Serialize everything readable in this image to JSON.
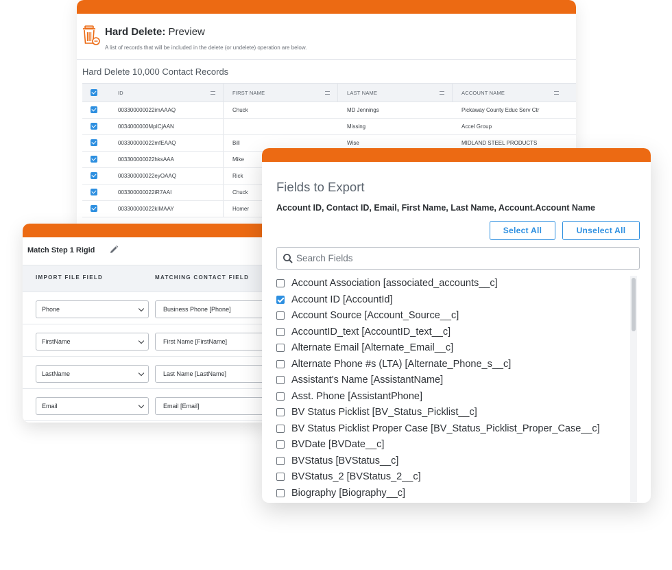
{
  "hard_delete": {
    "title_bold": "Hard Delete:",
    "title_rest": " Preview",
    "subtitle": "A list of records that will be included in the delete (or undelete) operation are below.",
    "heading": "Hard Delete 10,000 Contact Records",
    "columns": [
      "ID",
      "FIRST NAME",
      "LAST NAME",
      "ACCOUNT NAME"
    ],
    "rows": [
      {
        "id": "003300000022imAAAQ",
        "first": "Chuck",
        "last": "MD Jennings",
        "account": "Pickaway County Educ Serv Ctr"
      },
      {
        "id": "0034000000MpICjAAN",
        "first": "",
        "last": "Missing",
        "account": "Accel Group"
      },
      {
        "id": "003300000022mfEAAQ",
        "first": "Bill",
        "last": "Wise",
        "account": "MIDLAND STEEL PRODUCTS"
      },
      {
        "id": "003300000022hksAAA",
        "first": "Mike",
        "last": "",
        "account": ""
      },
      {
        "id": "003300000022eyOAAQ",
        "first": "Rick",
        "last": "",
        "account": ""
      },
      {
        "id": "003300000022iR7AAI",
        "first": "Chuck",
        "last": "",
        "account": ""
      },
      {
        "id": "003300000022kIMAAY",
        "first": "Homer",
        "last": "",
        "account": ""
      }
    ]
  },
  "match_step": {
    "title": "Match Step 1 Rigid",
    "col_import": "IMPORT FILE FIELD",
    "col_matching": "MATCHING CONTACT FIELD",
    "rows": [
      {
        "import": "Phone",
        "match": "Business Phone [Phone]"
      },
      {
        "import": "FirstName",
        "match": "First Name [FirstName]"
      },
      {
        "import": "LastName",
        "match": "Last Name [LastName]"
      },
      {
        "import": "Email",
        "match": "Email [Email]"
      }
    ]
  },
  "fields_export": {
    "title": "Fields to Export",
    "selected": "Account ID, Contact ID, Email, First Name, Last Name, Account.Account Name",
    "select_all": "Select All",
    "unselect_all": "Unselect All",
    "search_placeholder": "Search Fields",
    "items": [
      {
        "label": "Account Association [associated_accounts__c]",
        "checked": false
      },
      {
        "label": "Account ID [AccountId]",
        "checked": true
      },
      {
        "label": "Account Source [Account_Source__c]",
        "checked": false
      },
      {
        "label": "AccountID_text [AccountID_text__c]",
        "checked": false
      },
      {
        "label": "Alternate Email [Alternate_Email__c]",
        "checked": false
      },
      {
        "label": "Alternate Phone #s (LTA) [Alternate_Phone_s__c]",
        "checked": false
      },
      {
        "label": "Assistant's Name [AssistantName]",
        "checked": false
      },
      {
        "label": "Asst. Phone [AssistantPhone]",
        "checked": false
      },
      {
        "label": "BV Status Picklist [BV_Status_Picklist__c]",
        "checked": false
      },
      {
        "label": "BV Status Picklist Proper Case [BV_Status_Picklist_Proper_Case__c]",
        "checked": false
      },
      {
        "label": "BVDate [BVDate__c]",
        "checked": false
      },
      {
        "label": "BVStatus [BVStatus__c]",
        "checked": false
      },
      {
        "label": "BVStatus_2 [BVStatus_2__c]",
        "checked": false
      },
      {
        "label": "Biography [Biography__c]",
        "checked": false
      }
    ]
  },
  "colors": {
    "accent_orange": "#ec6a13",
    "accent_blue": "#2d8fe0"
  }
}
